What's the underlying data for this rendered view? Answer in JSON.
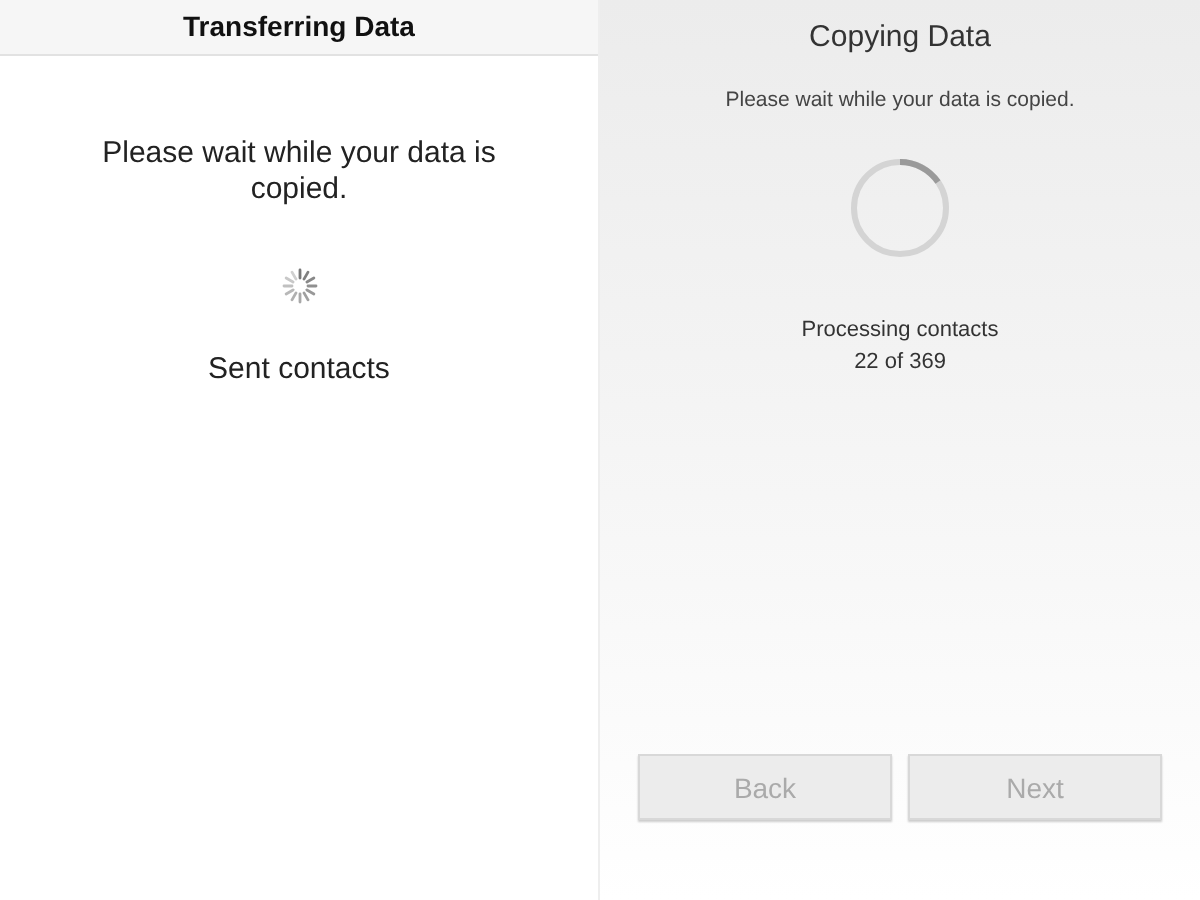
{
  "left_screen": {
    "title": "Transferring Data",
    "message": "Please wait while your data is copied.",
    "status": "Sent contacts"
  },
  "right_screen": {
    "title": "Copying Data",
    "message": "Please wait while your data is copied.",
    "status": "Processing contacts",
    "count": "22 of 369",
    "buttons": [
      {
        "label": "Back",
        "disabled": true
      },
      {
        "label": "Next",
        "disabled": true
      }
    ]
  }
}
